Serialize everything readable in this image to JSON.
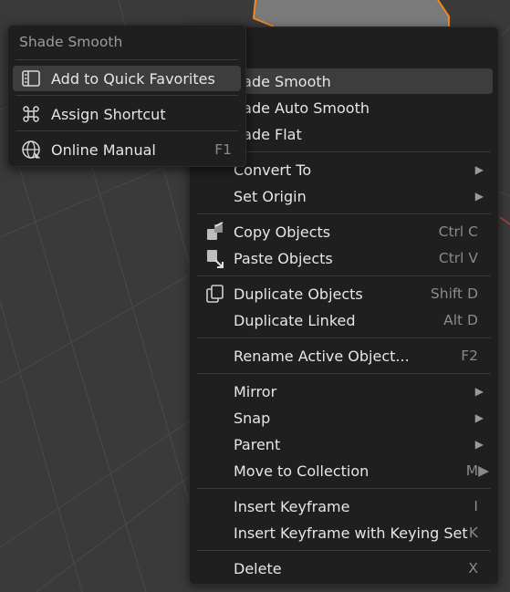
{
  "popup": {
    "title": "Shade Smooth",
    "items": [
      {
        "label": "Add to Quick Favorites",
        "icon": "favorites-icon"
      },
      {
        "label": "Assign Shortcut",
        "icon": "shortcut-icon"
      },
      {
        "label": "Online Manual",
        "shortcut": "F1",
        "icon": "globe-icon"
      }
    ]
  },
  "menu": {
    "items": [
      {
        "label": "hade Smooth"
      },
      {
        "label": "hade Auto Smooth"
      },
      {
        "label": "hade Flat"
      },
      {
        "label": "Convert To",
        "arrow": "▶"
      },
      {
        "label": "Set Origin",
        "arrow": "▶"
      },
      {
        "label": "Copy Objects",
        "shortcut": "Ctrl C",
        "icon": "copy-icon"
      },
      {
        "label": "Paste Objects",
        "shortcut": "Ctrl V",
        "icon": "paste-icon"
      },
      {
        "label": "Duplicate Objects",
        "shortcut": "Shift D",
        "icon": "duplicate-icon"
      },
      {
        "label": "Duplicate Linked",
        "shortcut": "Alt D"
      },
      {
        "label": "Rename Active Object...",
        "shortcut": "F2"
      },
      {
        "label": "Mirror",
        "arrow": "▶"
      },
      {
        "label": "Snap",
        "arrow": "▶"
      },
      {
        "label": "Parent",
        "arrow": "▶"
      },
      {
        "label": "Move to Collection",
        "shortcut": "M▶"
      },
      {
        "label": "Insert Keyframe",
        "shortcut": "I"
      },
      {
        "label": "Insert Keyframe with Keying Set",
        "shortcut": "K"
      },
      {
        "label": "Delete",
        "shortcut": "X"
      }
    ]
  }
}
